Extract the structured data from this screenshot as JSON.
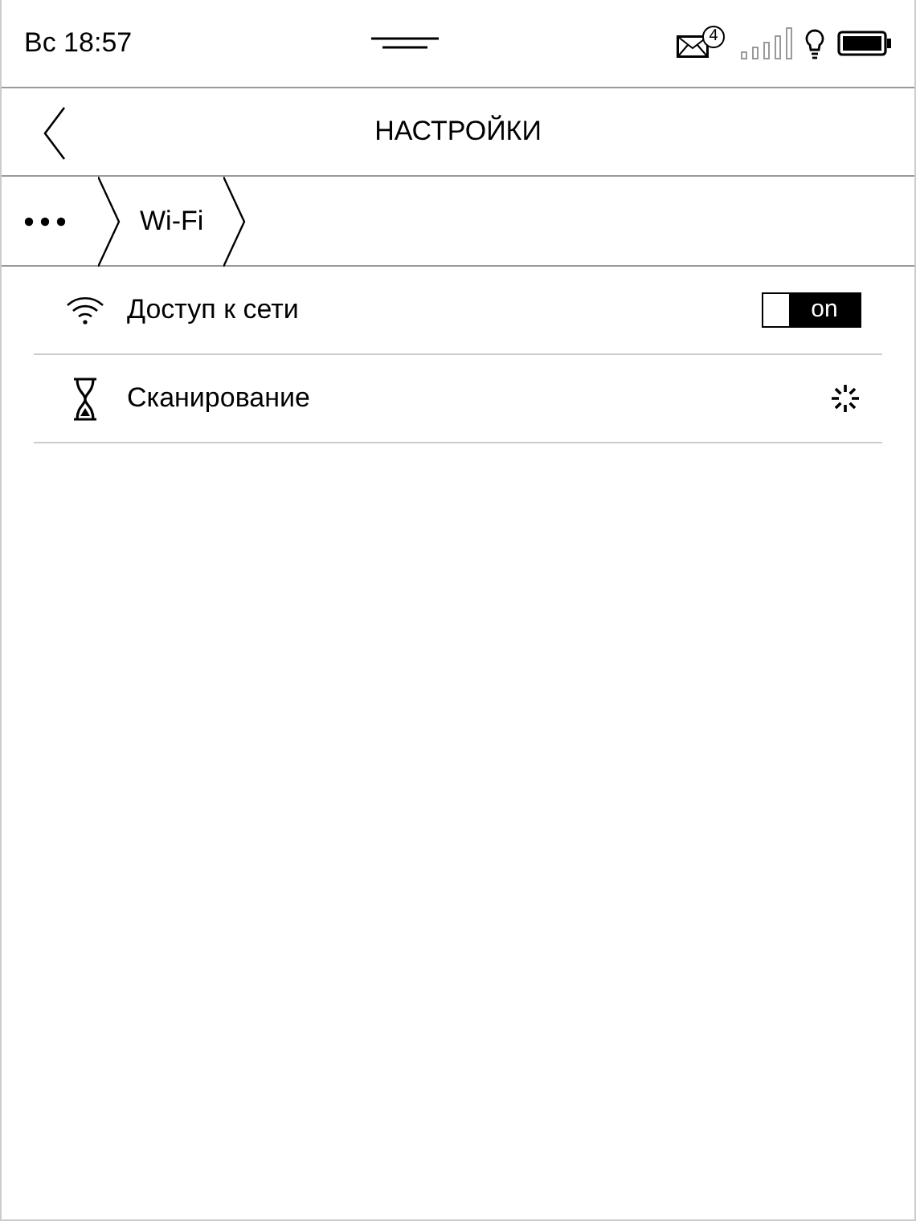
{
  "status_bar": {
    "time": "Вс 18:57",
    "mail_count": "4"
  },
  "header": {
    "title": "НАСТРОЙКИ"
  },
  "breadcrumb": [
    {
      "kind": "more"
    },
    {
      "kind": "label",
      "label": "Wi-Fi"
    }
  ],
  "rows": [
    {
      "kind": "toggle",
      "label": "Доступ к сети",
      "on": true,
      "toggle_text": "on"
    },
    {
      "kind": "spinner",
      "label": "Сканирование"
    }
  ]
}
